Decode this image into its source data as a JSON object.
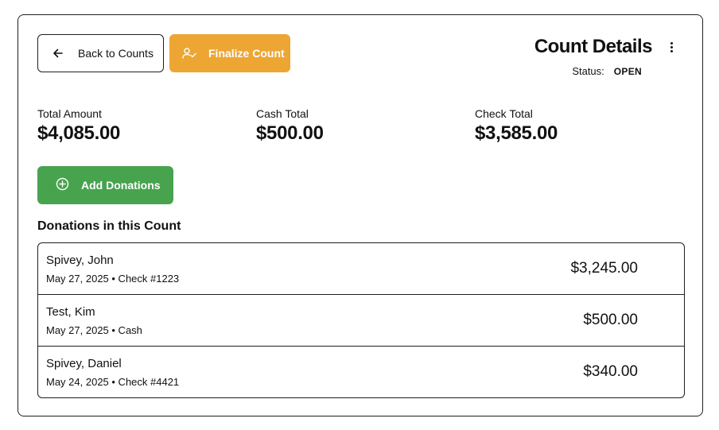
{
  "header": {
    "back_label": "Back to Counts",
    "finalize_label": "Finalize Count",
    "title": "Count Details",
    "status_label": "Status:",
    "status_value": "OPEN"
  },
  "totals": [
    {
      "label": "Total Amount",
      "value": "$4,085.00"
    },
    {
      "label": "Cash Total",
      "value": "$500.00"
    },
    {
      "label": "Check Total",
      "value": "$3,585.00"
    }
  ],
  "add_button_label": "Add Donations",
  "section_title": "Donations in this Count",
  "donations": [
    {
      "name": "Spivey, John",
      "meta": "May 27, 2025 • Check #1223",
      "amount": "$3,245.00"
    },
    {
      "name": "Test, Kim",
      "meta": "May 27, 2025 • Cash",
      "amount": "$500.00"
    },
    {
      "name": "Spivey, Daniel",
      "meta": "May 24, 2025 • Check #4421",
      "amount": "$340.00"
    }
  ],
  "colors": {
    "finalize": "#eda634",
    "add": "#47a34e",
    "border": "#1f1f1f"
  },
  "icons": [
    "arrow-left-icon",
    "user-check-icon",
    "kebab-menu-icon",
    "plus-circle-icon"
  ]
}
